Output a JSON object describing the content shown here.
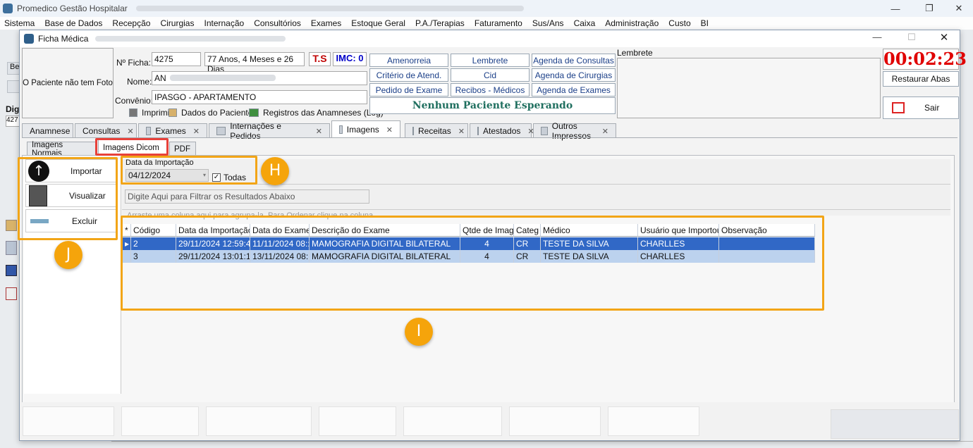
{
  "app": {
    "title": "Promedico Gestão Hospitalar",
    "menu": [
      "Sistema",
      "Base de Dados",
      "Recepção",
      "Cirurgias",
      "Internação",
      "Consultórios",
      "Exames",
      "Estoque Geral",
      "P.A./Terapias",
      "Faturamento",
      "Sus/Ans",
      "Caixa",
      "Administração",
      "Custo",
      "BI"
    ]
  },
  "window": {
    "title": "Ficha Médica"
  },
  "patient": {
    "photo_text": "O Paciente não tem Foto",
    "ficha_label": "Nº Ficha:",
    "ficha_value": "4275",
    "age": "77 Anos, 4 Meses e 26 Dias",
    "ts": "T.S",
    "imc": "IMC: 0",
    "nome_label": "Nome:",
    "nome_value": "AN",
    "convenio_label": "Convênio:",
    "convenio_value": "IPASGO - APARTAMENTO",
    "imprimir": "Imprimir",
    "dados_paciente": "Dados do Paciente",
    "registros": "Registros das Anamneses (Log)"
  },
  "actions": {
    "col1": [
      "Amenorreia",
      "Critério de Atend.",
      "Pedido de Exame"
    ],
    "col2": [
      "Lembrete",
      "Cid",
      "Recibos - Médicos"
    ],
    "col3": [
      "Agenda de Consultas",
      "Agenda de Cirurgias",
      "Agenda de Exames"
    ],
    "waiting": "Nenhum Paciente Esperando"
  },
  "lembrete_label": "Lembrete",
  "timer": "00:02:23",
  "restaurar_abas": "Restaurar Abas",
  "sair": "Sair",
  "tabs": [
    "Anamnese",
    "Consultas",
    "Exames",
    "Internações e Pedidos",
    "Imagens",
    "Receitas",
    "Atestados",
    "Outros Impressos"
  ],
  "subtabs": [
    "Imagens Normais",
    "Imagens Dicom",
    "PDF"
  ],
  "side_buttons": [
    "Importar",
    "Visualizar",
    "Excluir"
  ],
  "filter": {
    "date_label": "Data da Importação",
    "date_value": "04/12/2024",
    "todas_label": "Todas",
    "search_placeholder": "Digite Aqui para Filtrar os Resultados Abaixo",
    "group_hint": "Arraste uma coluna aqui para agrupa-la. Para Ordenar clique na coluna."
  },
  "grid": {
    "columns": [
      "Código",
      "Data da Importação",
      "Data do Exame",
      "Descrição do Exame",
      "Qtde de Imag",
      "Categ",
      "Médico",
      "Usuário que Importou",
      "Observação"
    ],
    "rows": [
      [
        "2",
        "29/11/2024 12:59:4:",
        "11/11/2024 08::",
        "MAMOGRAFIA DIGITAL BILATERAL",
        "4",
        "CR",
        "TESTE DA SILVA",
        "CHARLLES",
        ""
      ],
      [
        "3",
        "29/11/2024 13:01:1(",
        "13/11/2024 08::",
        "MAMOGRAFIA DIGITAL BILATERAL",
        "4",
        "CR",
        "TESTE DA SILVA",
        "CHARLLES",
        ""
      ]
    ]
  },
  "callouts": [
    "H",
    "I",
    "J"
  ],
  "colors": {
    "highlight": "#f2a517",
    "selected_row": "#3168c6",
    "second_row": "#bcd2ee",
    "timer": "#e00000"
  }
}
